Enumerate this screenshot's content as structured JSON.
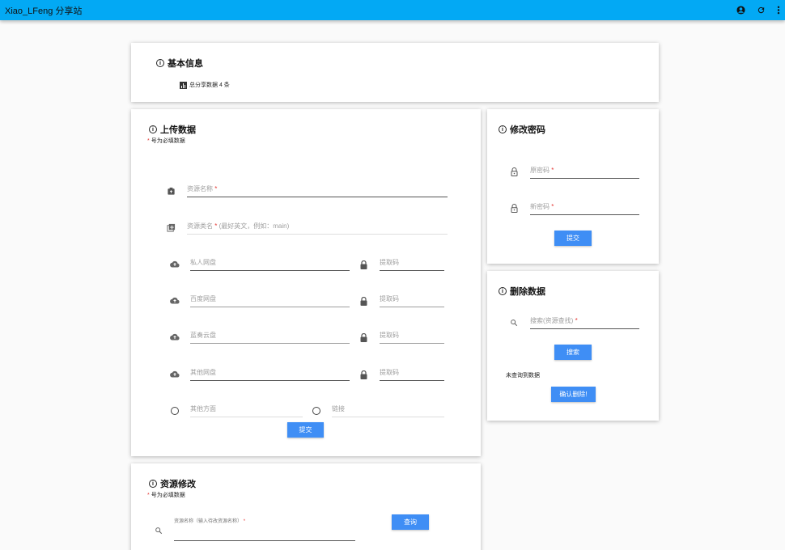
{
  "app": {
    "title": "Xiao_LFeng 分享站"
  },
  "basic_info": {
    "title": "基本信息",
    "stat_text": "总分享数据 4 条"
  },
  "upload": {
    "title": "上传数据",
    "required_note_star": "*",
    "required_note": "号为必填数据",
    "resource_name": "资源名称",
    "resource_category": "资源类名",
    "resource_category_hint": "(最好英文，例如：main)",
    "req_star": "*",
    "private_disk": "私人网盘",
    "baidu_disk": "百度网盘",
    "lanzou_disk": "蓝奏云盘",
    "other_disk": "其他网盘",
    "extract_code": "提取码",
    "other_method": "其他方面",
    "link": "链接",
    "submit": "提交"
  },
  "password": {
    "title": "修改密码",
    "old_pw": "原密码",
    "new_pw": "新密码",
    "submit": "提交"
  },
  "delete": {
    "title": "删除数据",
    "search_placeholder": "搜索(资源查找)",
    "search_button": "搜索",
    "no_data": "未查询到数据",
    "confirm_button": "确认删除!"
  },
  "modify": {
    "title": "资源修改",
    "required_note": "号为必填数据",
    "search_label": "资源名称（输入待改资源名称）",
    "query_button": "查询"
  }
}
